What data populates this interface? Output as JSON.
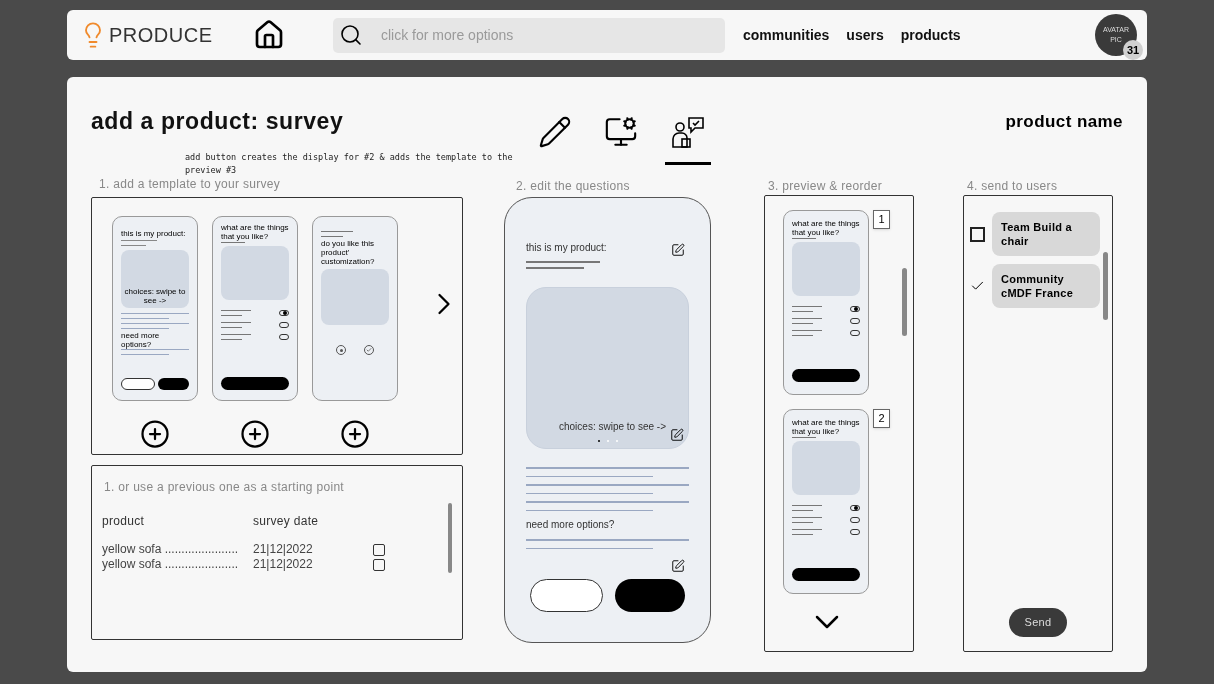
{
  "nav": {
    "logo": "PRODUCE",
    "search_placeholder": "click for more options",
    "links": [
      "communities",
      "users",
      "products"
    ],
    "avatar": {
      "text": "AVATAR PIC",
      "badge": "31"
    }
  },
  "page": {
    "title": "add a product: survey",
    "note": "add button creates the display for #2 & adds the template to the preview #3",
    "product_name": "product name"
  },
  "tabs": [
    {
      "kind": "pencil",
      "selected": false
    },
    {
      "kind": "settings",
      "selected": false
    },
    {
      "kind": "survey",
      "selected": true
    }
  ],
  "templates": {
    "label": "1. add a template to your survey",
    "items": [
      {
        "kind": "carousel",
        "title": "this is my product:",
        "caption": "choices: swipe to see ->",
        "footer": "need more options?"
      },
      {
        "kind": "toggles",
        "title": "what are the things that you like?",
        "toggles": [
          {
            "on": true
          },
          {
            "on": false
          },
          {
            "on": false
          }
        ]
      },
      {
        "kind": "rating",
        "title": "do you like this product' customization?"
      }
    ]
  },
  "previous": {
    "label": "1. or use a previous one as a starting point",
    "columns": [
      "product",
      "survey date"
    ],
    "rows": [
      {
        "product": "yellow sofa ......................",
        "date": "21|12|2022",
        "checked": false
      },
      {
        "product": "yellow sofa ......................",
        "date": "21|12|2022",
        "checked": false
      }
    ]
  },
  "editor": {
    "label": "2. edit the questions",
    "title": "this is my product:",
    "caption": "choices: swipe to see ->",
    "footer": "need more options?"
  },
  "preview": {
    "label": "3. preview & reorder",
    "items": [
      {
        "number": "1",
        "title": "what are the things that you like?",
        "toggles": [
          {
            "on": true
          },
          {
            "on": false
          },
          {
            "on": false
          }
        ]
      },
      {
        "number": "2",
        "title": "what are the things that you like?",
        "toggles": [
          {
            "on": true
          },
          {
            "on": false
          },
          {
            "on": false
          }
        ]
      }
    ]
  },
  "send": {
    "label": "4. send to users",
    "items": [
      {
        "name": "Team Build a chair",
        "checked": false
      },
      {
        "name": "Community cMDF France",
        "checked": true
      }
    ],
    "button": "Send"
  }
}
